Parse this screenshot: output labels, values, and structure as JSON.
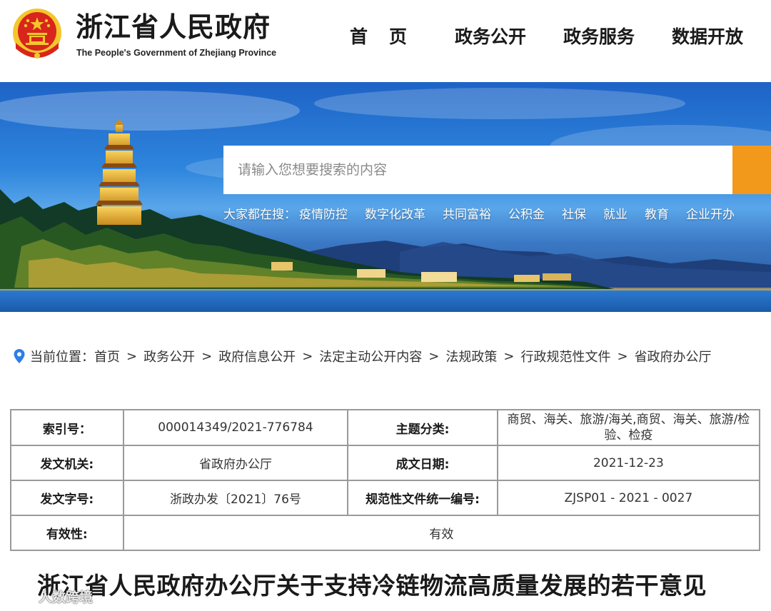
{
  "header": {
    "title": "浙江省人民政府",
    "subtitle": "The People's Government of Zhejiang Province",
    "nav": [
      {
        "label": "首页"
      },
      {
        "label": "政务公开"
      },
      {
        "label": "政务服务"
      },
      {
        "label": "数据开放"
      }
    ]
  },
  "search": {
    "placeholder": "请输入您想要搜索的内容",
    "hot_label": "大家都在搜：",
    "hot_terms": [
      "疫情防控",
      "数字化改革",
      "共同富裕",
      "公积金",
      "社保",
      "就业",
      "教育",
      "企业开办"
    ]
  },
  "breadcrumb": {
    "label": "当前位置：",
    "items": [
      "首页",
      "政务公开",
      "政府信息公开",
      "法定主动公开内容",
      "法规政策",
      "行政规范性文件",
      "省政府办公厅"
    ],
    "separator": ">"
  },
  "meta": {
    "index_label": "索引号：",
    "index_value": "000014349/2021-776784",
    "topic_label": "主题分类:",
    "topic_value": "商贸、海关、旅游/海关,商贸、海关、旅游/检验、检疫",
    "issuer_label": "发文机关:",
    "issuer_value": "省政府办公厅",
    "date_label": "成文日期:",
    "date_value": "2021-12-23",
    "docno_label": "发文字号:",
    "docno_value": "浙政办发〔2021〕76号",
    "code_label": "规范性文件统一编号:",
    "code_value": "ZJSP01 - 2021 - 0027",
    "validity_label": "有效性:",
    "validity_value": "有效"
  },
  "article": {
    "title": "浙江省人民政府办公厅关于支持冷链物流高质量发展的若干意见"
  },
  "watermark": {
    "text": "人数跨境"
  },
  "colors": {
    "search_button": "#f2991c",
    "emblem_red": "#d8261c",
    "emblem_gold": "#f3c72c",
    "table_border": "#9a9a9a"
  }
}
